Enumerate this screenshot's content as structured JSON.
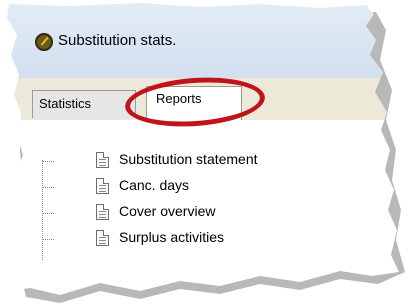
{
  "window": {
    "title": "Substitution stats.",
    "icon": "clock-icon"
  },
  "tabs": [
    {
      "label": "Statistics",
      "selected": false
    },
    {
      "label": "Reports",
      "selected": true
    }
  ],
  "tree": {
    "items": [
      {
        "label": "Substitution statement",
        "icon": "document-icon"
      },
      {
        "label": "Canc. days",
        "icon": "document-icon"
      },
      {
        "label": "Cover overview",
        "icon": "document-icon"
      },
      {
        "label": "Surplus activities",
        "icon": "document-icon"
      }
    ]
  },
  "annotation": {
    "highlight_color": "#c0141a",
    "highlight_target": "Reports tab"
  }
}
